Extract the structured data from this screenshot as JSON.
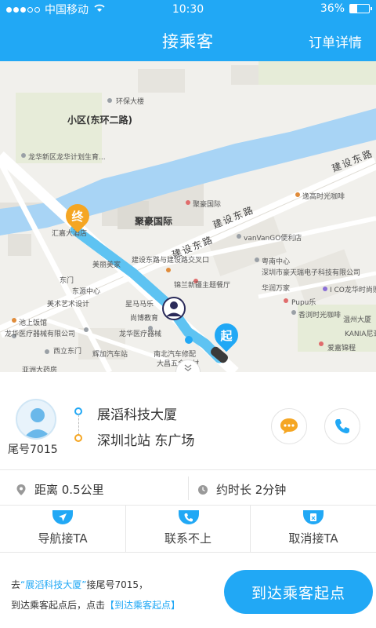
{
  "status_bar": {
    "carrier": "中国移动",
    "time": "10:30",
    "battery": "36%",
    "battery_level": 0.36
  },
  "header": {
    "title": "接乘客",
    "order_details": "订单详情"
  },
  "map": {
    "labels": {
      "district": "小区(东环二路)",
      "juhao": "聚豪国际",
      "road_jianshe_1": "建设东路",
      "road_jianshe_2": "建设东路",
      "road_jianshe_3": "建设东路",
      "env_building": "环保大楼",
      "longhua_gov": "龙华新区龙华计划生育...",
      "huanhuan": "逸高时光咖啡",
      "juhao_hotel": "聚豪国际",
      "vanvango": "vanVanGO便利店",
      "jianshe_stop": "建设东路与建设路交叉口",
      "yuemei": "粤南中心",
      "shenzhen_dai": "深圳市豪天瑞电子科技有限公司",
      "huarun": "华润万家",
      "icoshop": "I CO龙华时尚购物广场",
      "jinglan": "锦兰新疆主题餐厅",
      "pupu": "Pupu乐",
      "xiangyu": "香浏时光咖啡",
      "meiyi": "美丽美家",
      "longhua_hospital": "龙华医疗器械有限公司",
      "east_gate": "东门",
      "dongyuan": "东源中心",
      "meishu": "美术艺术设计",
      "shanzhuang": "汇嘉大酒店",
      "chimu": "池上饭馆",
      "xidongmen": "西立东门",
      "fenghua": "辉加汽车站",
      "honda": "大昌五金建材",
      "yaming": "亚洲大药房",
      "gangdun": "龙华医疗器械",
      "kanian": "KANIA尼亚",
      "niyabao": "南北汽车修配",
      "wenzhou": "温州大厦",
      "shouming": "星马马乐",
      "aijia": "爱嘉锦程",
      "shangban": "尚博教育"
    },
    "pins": {
      "end": "终",
      "start": "起"
    }
  },
  "card": {
    "tail_number": "尾号7015",
    "from": "展滔科技大厦",
    "to": "深圳北站 东广场",
    "distance": "距离 0.5公里",
    "duration": "约时长 2分钟"
  },
  "actions": {
    "navigate": "导航接TA",
    "contact_fail": "联系不上",
    "cancel": "取消接TA"
  },
  "footer": {
    "hint_prefix": "去",
    "hint_place": "“展滔科技大厦”",
    "hint_mid": "接尾号7015，",
    "hint_line2": "到达乘客起点后，点击",
    "hint_link": "【到达乘客起点】",
    "arrive_button": "到达乘客起点"
  },
  "colors": {
    "primary": "#21a8f5",
    "route": "#5ec3f2",
    "end_pin": "#f5a623",
    "start_pin": "#21a8f5",
    "water": "#a8d4f5"
  }
}
